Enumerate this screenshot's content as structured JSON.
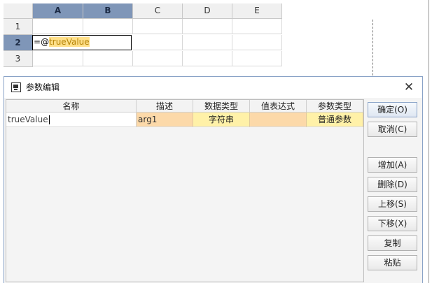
{
  "sheet": {
    "columns": [
      "A",
      "B",
      "C",
      "D",
      "E"
    ],
    "rows": [
      "1",
      "2",
      "3"
    ],
    "active_cell": {
      "eq": "=",
      "at": "@",
      "ref": "trueValue"
    }
  },
  "dialog": {
    "title": "参数编辑",
    "close_glyph": "✕",
    "headers": {
      "name": "名称",
      "desc": "描述",
      "dtype": "数据类型",
      "expr": "值表达式",
      "ptype": "参数类型"
    },
    "row": {
      "name": "trueValue",
      "desc": "arg1",
      "dtype": "字符串",
      "expr": "",
      "ptype": "普通参数"
    },
    "buttons": {
      "ok": "确定(O)",
      "cancel": "取消(C)",
      "add": "增加(A)",
      "delete": "删除(D)",
      "up": "上移(S)",
      "down": "下移(X)",
      "copy": "复制",
      "paste": "粘贴"
    }
  },
  "colors": {
    "selected_header": "#7f96b8",
    "orange_cell": "#fcd9a9",
    "yellow_cell": "#fff1a8",
    "dialog_border": "#8aa3c7"
  }
}
